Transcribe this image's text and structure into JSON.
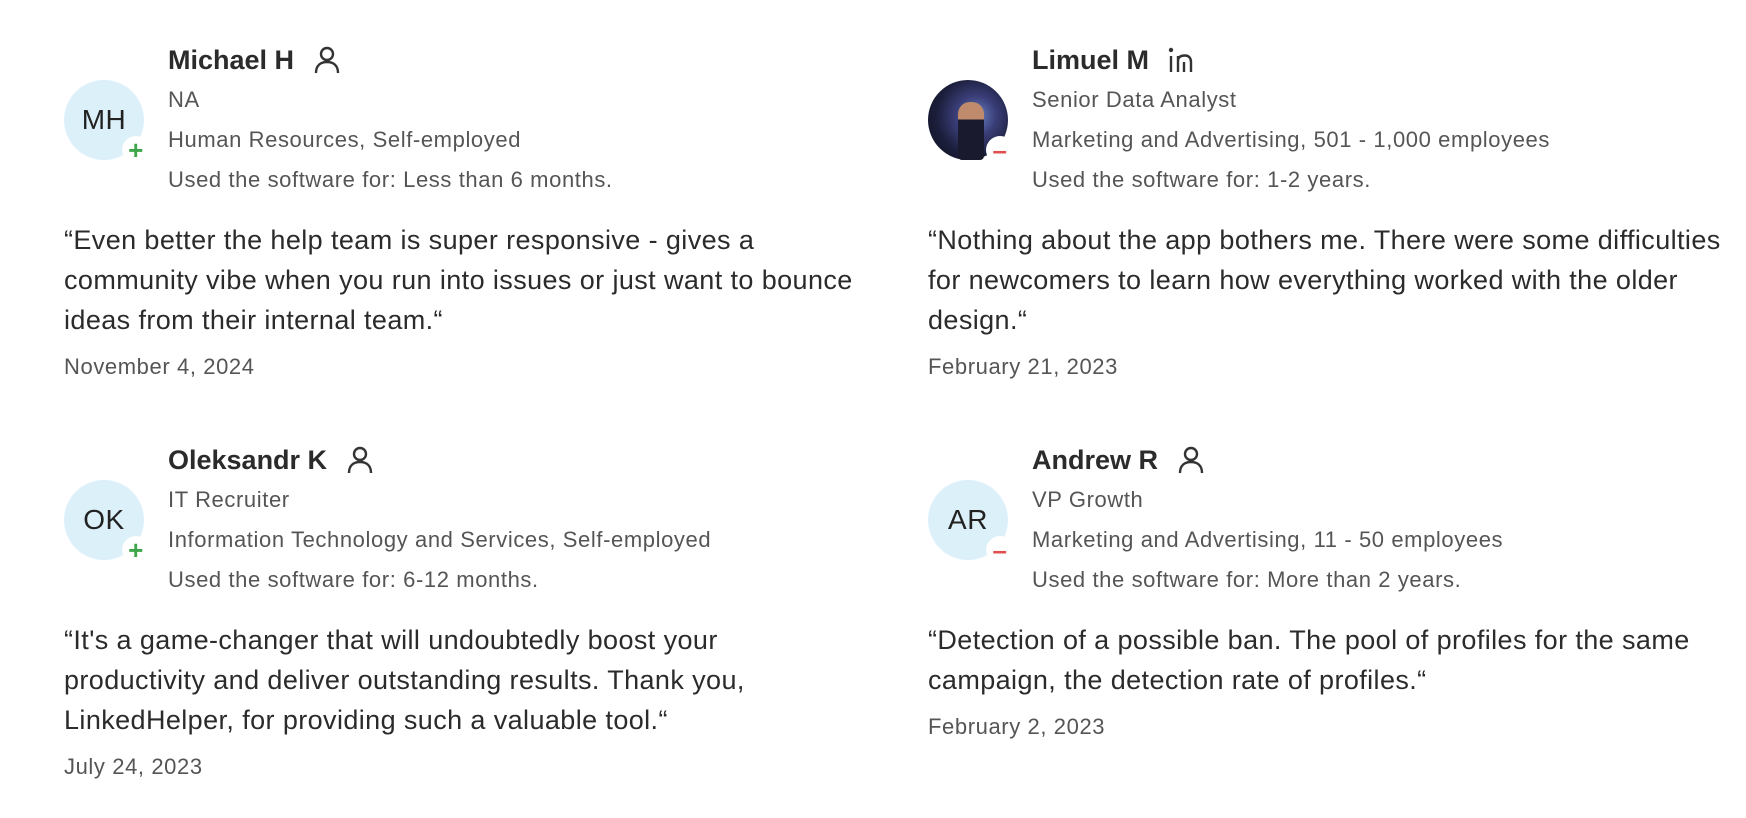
{
  "reviews": [
    {
      "initials": "MH",
      "avatar_type": "initials",
      "badge": "+",
      "badge_color": "#3ea64a",
      "name": "Michael H",
      "source_icon": "user-icon",
      "job_title": "NA",
      "industry": "Human Resources, Self-employed",
      "usage": "Used the software for: Less than 6 months.",
      "quote": "“Even better the help team is super responsive - gives a community vibe when you run into issues or just want to bounce ideas from their internal team.“",
      "date": "November 4, 2024"
    },
    {
      "initials": "",
      "avatar_type": "photo",
      "badge": "–",
      "badge_color": "#e05050",
      "name": "Limuel M",
      "source_icon": "linkedin-icon",
      "job_title": "Senior Data Analyst",
      "industry": "Marketing and Advertising, 501 - 1,000 employees",
      "usage": "Used the software for: 1-2 years.",
      "quote": "“Nothing about the app bothers me. There were some difficulties for newcomers to learn how everything worked with the older design.“",
      "date": "February 21, 2023"
    },
    {
      "initials": "OK",
      "avatar_type": "initials",
      "badge": "+",
      "badge_color": "#3ea64a",
      "name": "Oleksandr K",
      "source_icon": "user-icon",
      "job_title": "IT Recruiter",
      "industry": "Information Technology and Services, Self-employed",
      "usage": "Used the software for: 6-12 months.",
      "quote": "“It's a game-changer that will undoubtedly boost your productivity and deliver outstanding results. Thank you, LinkedHelper, for providing such a valuable tool.“",
      "date": "July 24, 2023"
    },
    {
      "initials": "AR",
      "avatar_type": "initials",
      "badge": "–",
      "badge_color": "#e05050",
      "name": "Andrew R",
      "source_icon": "user-icon",
      "job_title": "VP Growth",
      "industry": "Marketing and Advertising, 11 - 50 employees",
      "usage": "Used the software for: More than 2 years.",
      "quote": "“Detection of a possible ban. The pool of profiles for the same campaign, the detection rate of profiles.“",
      "date": "February 2, 2023"
    }
  ]
}
